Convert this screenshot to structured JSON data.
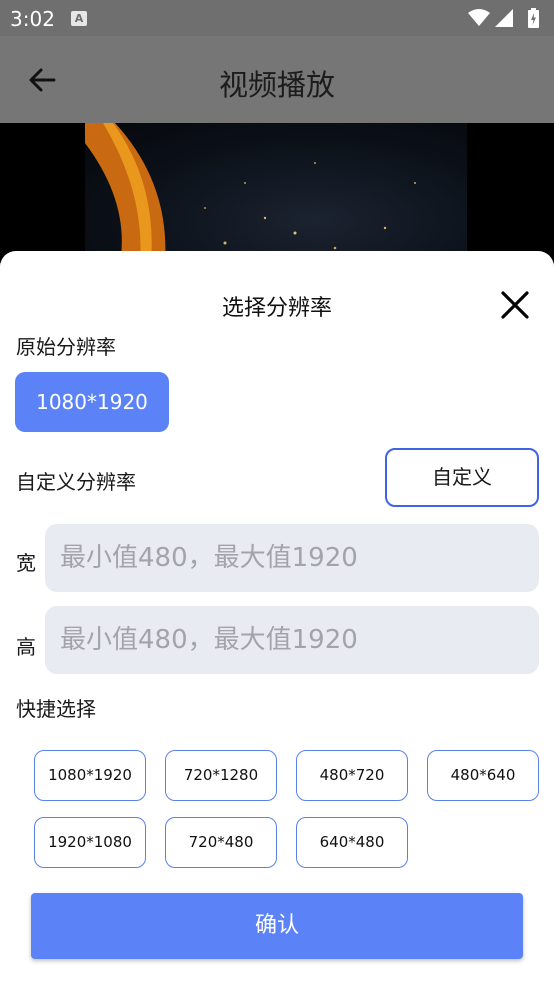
{
  "status_bar": {
    "time": "3:02",
    "notification_icon_letter": "A",
    "icons": [
      "wifi-icon",
      "signal-icon",
      "battery-charging-icon"
    ]
  },
  "app_bar": {
    "title": "视频播放",
    "back_icon": "arrow-left-icon"
  },
  "sheet": {
    "title": "选择分辨率",
    "close_icon": "close-icon",
    "original_label": "原始分辨率",
    "original_value": "1080*1920",
    "custom_label": "自定义分辨率",
    "custom_button": "自定义",
    "width_label": "宽",
    "width_placeholder": "最小值480，最大值1920",
    "height_label": "高",
    "height_placeholder": "最小值480，最大值1920",
    "quick_label": "快捷选择",
    "quick_options": [
      "1080*1920",
      "720*1280",
      "480*720",
      "480*640",
      "1920*1080",
      "720*480",
      "640*480"
    ],
    "confirm": "确认"
  },
  "colors": {
    "accent": "#5b83f7",
    "outline": "#3f64e5",
    "input_bg": "#e9ebf2",
    "overlay": "#777777"
  }
}
